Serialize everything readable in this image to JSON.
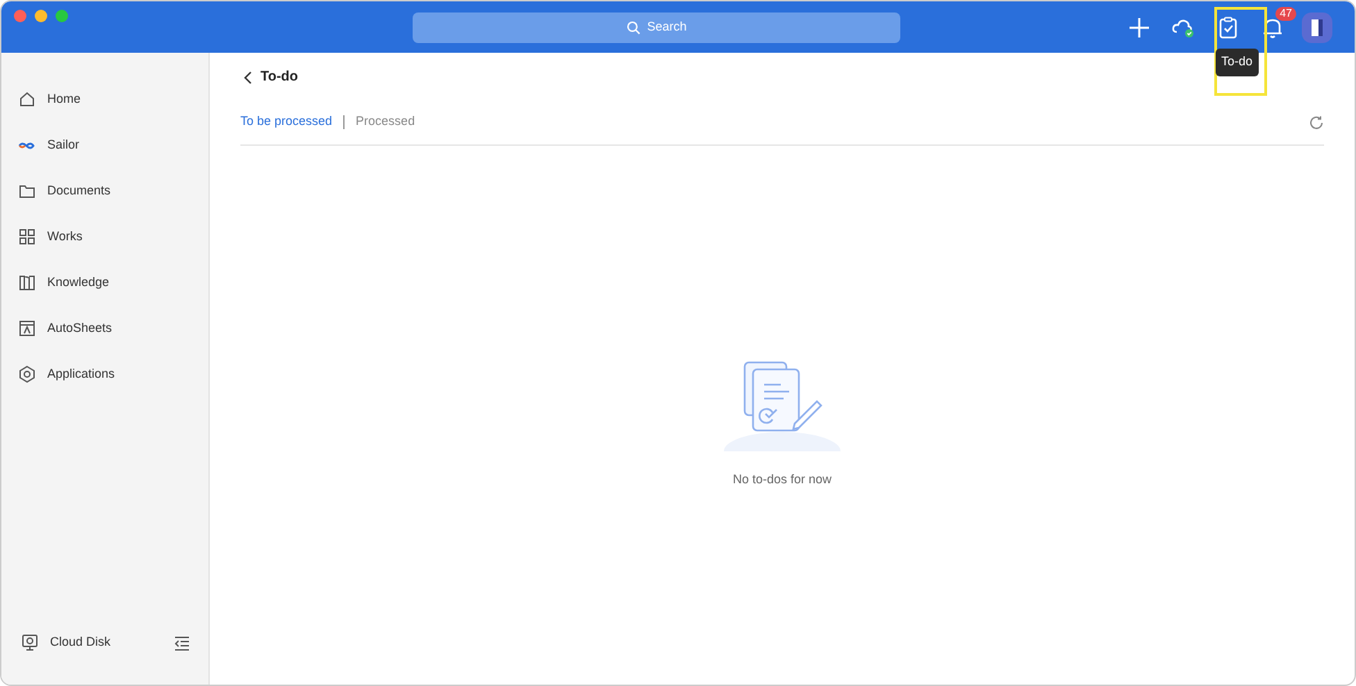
{
  "search": {
    "label": "Search"
  },
  "toolbar": [
    {
      "kind": "add",
      "highlighted": false
    },
    {
      "kind": "cloud",
      "highlighted": false
    },
    {
      "kind": "todo",
      "highlighted": true,
      "tooltip": "To-do"
    },
    {
      "kind": "bell",
      "highlighted": false,
      "badge": "47"
    },
    {
      "kind": "avatar",
      "highlighted": false
    }
  ],
  "sidebar": {
    "items": [
      {
        "kind": "home",
        "label": "Home",
        "selected": false
      },
      {
        "kind": "sailor",
        "label": "Sailor",
        "selected": false
      },
      {
        "kind": "folder",
        "label": "Documents",
        "selected": false
      },
      {
        "kind": "grid",
        "label": "Works",
        "selected": false
      },
      {
        "kind": "book",
        "label": "Knowledge",
        "selected": false
      },
      {
        "kind": "sheet",
        "label": "AutoSheets",
        "selected": false
      },
      {
        "kind": "apps",
        "label": "Applications",
        "selected": false
      }
    ],
    "footer": {
      "label": "Cloud Disk"
    }
  },
  "page": {
    "title": "To-do",
    "tabs": [
      {
        "label": "To be processed",
        "selected": true
      },
      {
        "label": "Processed",
        "selected": false
      }
    ],
    "empty_state": "No to-dos for now"
  }
}
